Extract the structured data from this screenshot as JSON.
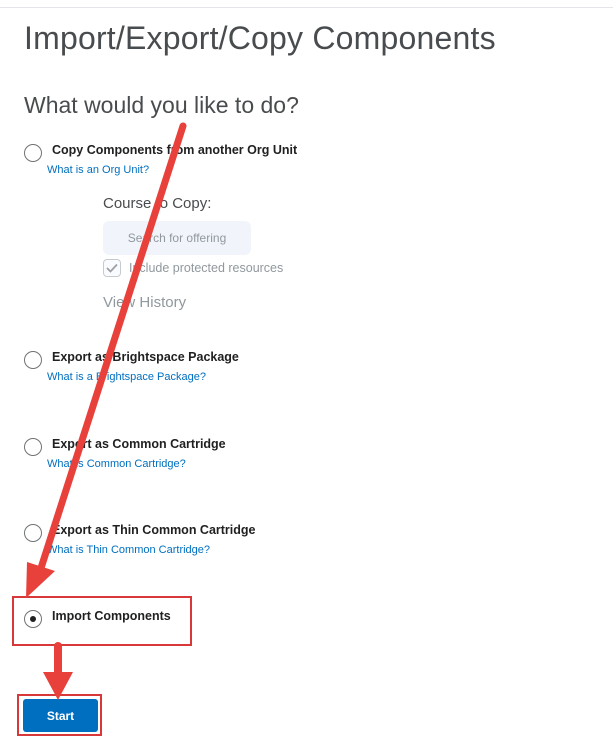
{
  "page": {
    "title": "Import/Export/Copy Components",
    "question": "What would you like to do?"
  },
  "options": [
    {
      "label": "Copy Components from another Org Unit",
      "help_link": "What is an Org Unit?",
      "selected": false
    },
    {
      "label": "Export as Brightspace Package",
      "help_link": "What is a Brightspace Package?",
      "selected": false
    },
    {
      "label": "Export as Common Cartridge",
      "help_link": "What is Common Cartridge?",
      "selected": false
    },
    {
      "label": "Export as Thin Common Cartridge",
      "help_link": "What is Thin Common Cartridge?",
      "selected": false
    },
    {
      "label": "Import Components",
      "selected": true
    }
  ],
  "copy_panel": {
    "course_label": "Course to Copy:",
    "search_button": "Search for offering",
    "include_protected_label": "Include protected resources",
    "include_protected_checked": true,
    "view_history": "View History"
  },
  "actions": {
    "start_label": "Start"
  },
  "annotation": {
    "color": "#e8403b",
    "highlight_color": "#d9383a"
  }
}
